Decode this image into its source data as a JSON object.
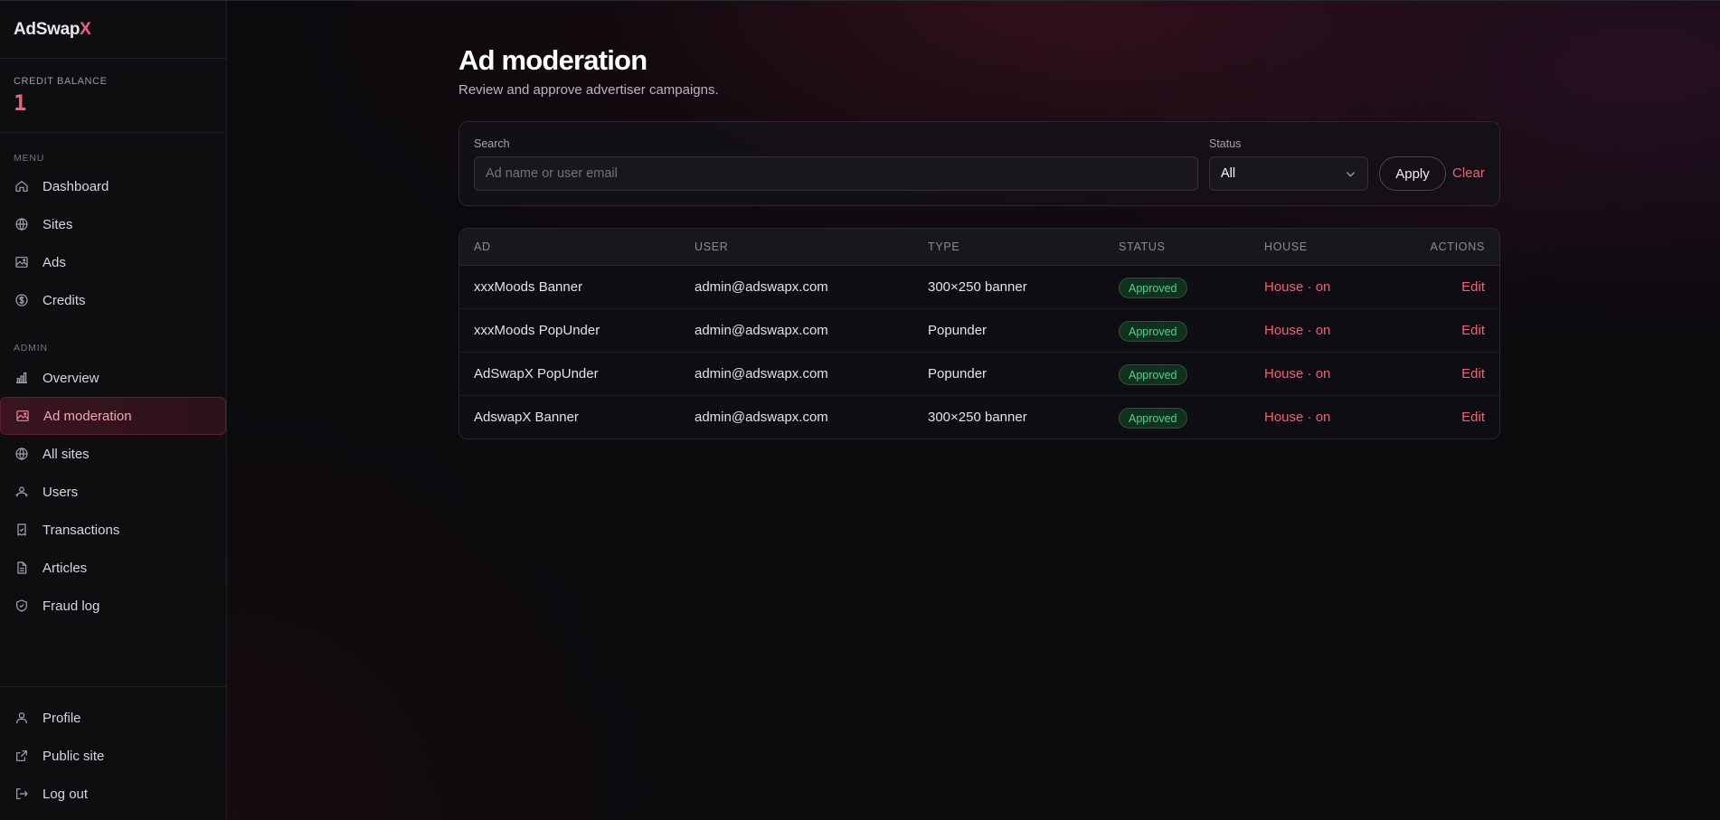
{
  "brand": {
    "name_main": "AdSwap",
    "name_accent": "X"
  },
  "credit": {
    "label": "CREDIT BALANCE",
    "value": "1"
  },
  "sidebar": {
    "menu_label": "MENU",
    "menu": [
      {
        "label": "Dashboard",
        "icon": "home-icon"
      },
      {
        "label": "Sites",
        "icon": "globe-icon"
      },
      {
        "label": "Ads",
        "icon": "image-icon"
      },
      {
        "label": "Credits",
        "icon": "dollar-icon"
      }
    ],
    "admin_label": "ADMIN",
    "admin": [
      {
        "label": "Overview",
        "icon": "chart-icon"
      },
      {
        "label": "Ad moderation",
        "icon": "image-icon",
        "active": true
      },
      {
        "label": "All sites",
        "icon": "globe-icon"
      },
      {
        "label": "Users",
        "icon": "users-icon"
      },
      {
        "label": "Transactions",
        "icon": "receipt-icon"
      },
      {
        "label": "Articles",
        "icon": "document-icon"
      },
      {
        "label": "Fraud log",
        "icon": "shield-icon"
      }
    ],
    "bottom": [
      {
        "label": "Profile",
        "icon": "user-icon"
      },
      {
        "label": "Public site",
        "icon": "external-link-icon"
      },
      {
        "label": "Log out",
        "icon": "logout-icon"
      }
    ]
  },
  "page": {
    "title": "Ad moderation",
    "subtitle": "Review and approve advertiser campaigns."
  },
  "filters": {
    "search_label": "Search",
    "search_placeholder": "Ad name or user email",
    "search_value": "",
    "status_label": "Status",
    "status_value": "All",
    "apply_label": "Apply",
    "clear_label": "Clear"
  },
  "table": {
    "headers": {
      "ad": "AD",
      "user": "USER",
      "type": "TYPE",
      "status": "STATUS",
      "house": "HOUSE",
      "actions": "ACTIONS"
    },
    "rows": [
      {
        "ad": "xxxMoods Banner",
        "user": "admin@adswapx.com",
        "type": "300×250 banner",
        "status": "Approved",
        "house": "House · on",
        "action": "Edit"
      },
      {
        "ad": "xxxMoods PopUnder",
        "user": "admin@adswapx.com",
        "type": "Popunder",
        "status": "Approved",
        "house": "House · on",
        "action": "Edit"
      },
      {
        "ad": "AdSwapX PopUnder",
        "user": "admin@adswapx.com",
        "type": "Popunder",
        "status": "Approved",
        "house": "House · on",
        "action": "Edit"
      },
      {
        "ad": "AdswapX Banner",
        "user": "admin@adswapx.com",
        "type": "300×250 banner",
        "status": "Approved",
        "house": "House · on",
        "action": "Edit"
      }
    ]
  },
  "colors": {
    "accent": "#f0607a",
    "success": "#4fd58a",
    "background": "#0b0a0d"
  }
}
